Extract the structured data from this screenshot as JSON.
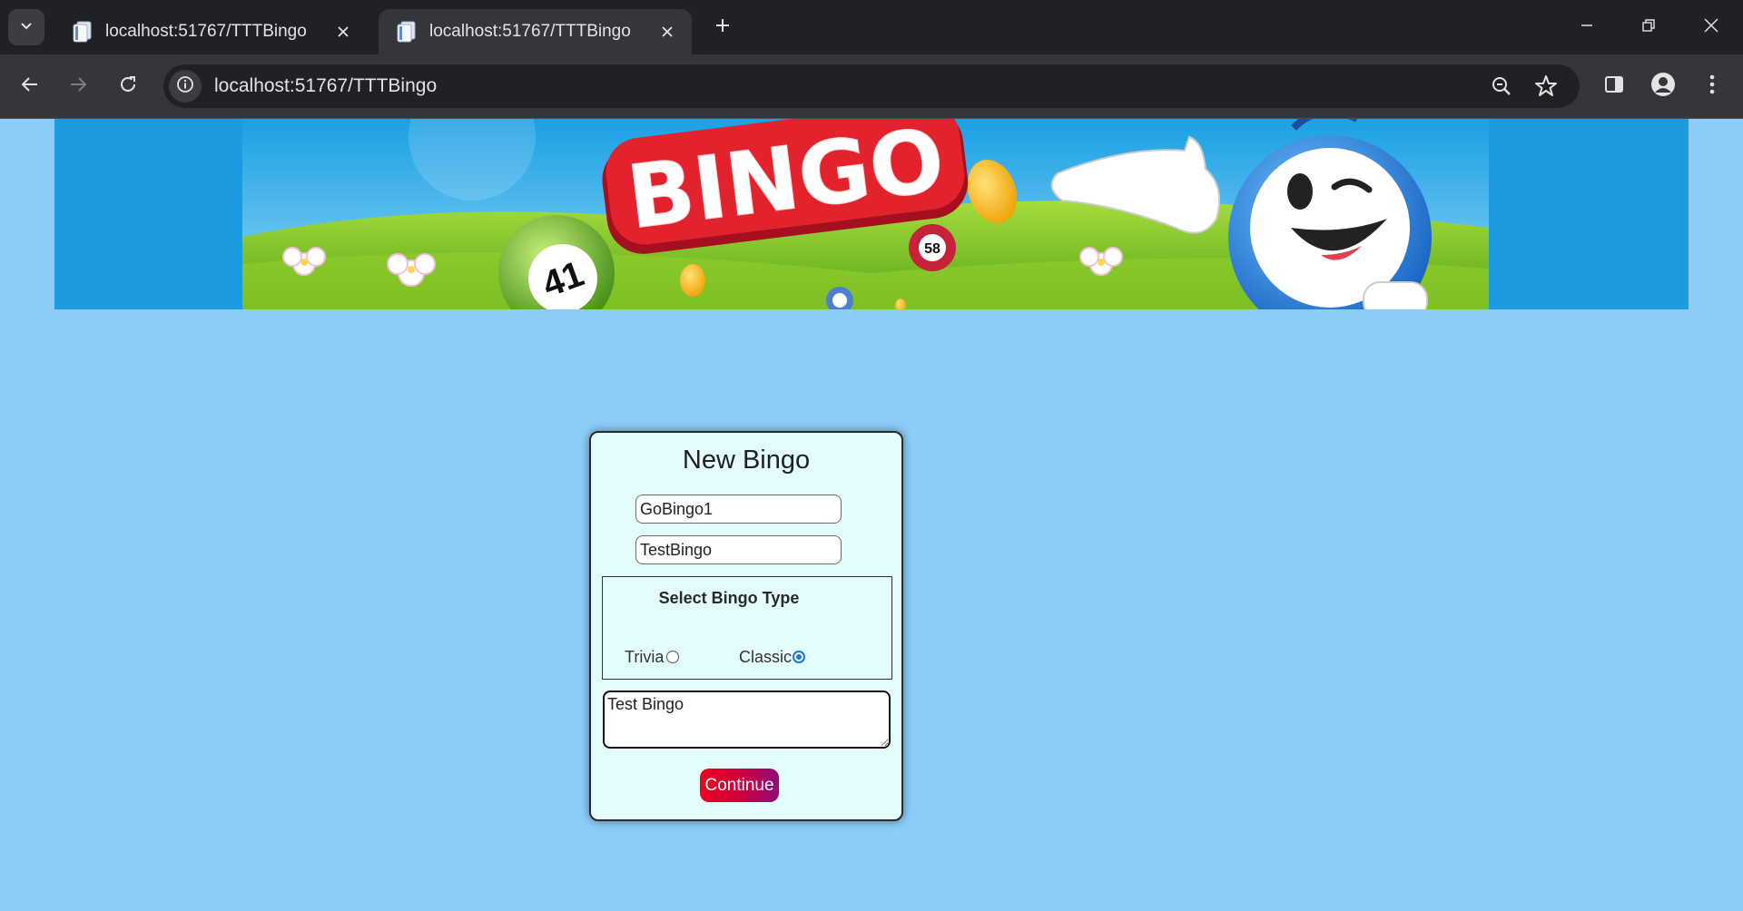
{
  "browser": {
    "tabs": [
      {
        "title": "localhost:51767/TTTBingo",
        "active": false
      },
      {
        "title": "localhost:51767/TTTBingo",
        "active": true
      }
    ],
    "url": "localhost:51767/TTTBingo",
    "theme_color": "#202124"
  },
  "banner": {
    "title": "BINGO",
    "ball_numbers": [
      "41",
      "58"
    ],
    "brand_color": "#e2232e"
  },
  "form": {
    "heading": "New Bingo",
    "name_value": "GoBingo1",
    "game_value": "TestBingo",
    "type_section_title": "Select Bingo Type",
    "options": [
      {
        "label": "Trivia",
        "checked": false
      },
      {
        "label": "Classic",
        "checked": true
      }
    ],
    "description_value": "Test Bingo",
    "continue_label": "Continue",
    "accent_color": "#1a73e8"
  }
}
